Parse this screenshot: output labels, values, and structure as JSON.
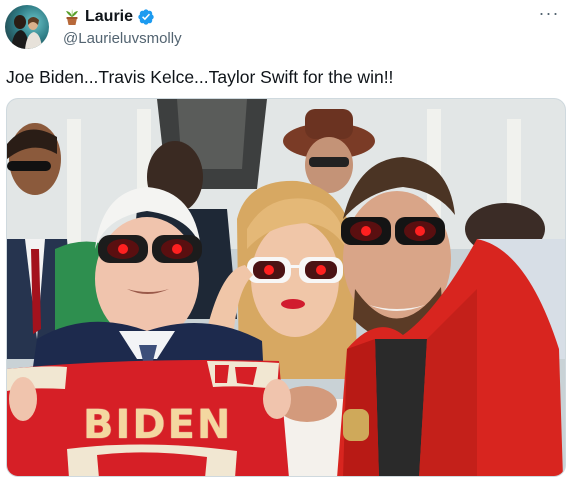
{
  "author": {
    "display_name": "Laurie",
    "handle": "@Laurieluvsmolly",
    "verified": true,
    "name_prefix_icon": "potted-plant-icon",
    "avatar_icon": "profile-photo"
  },
  "menu": {
    "more_icon": "more-horizontal-icon",
    "more_glyph": "···"
  },
  "tweet": {
    "text": "Joe Biden...Travis Kelce...Taylor Swift for the win!!"
  },
  "media": {
    "jersey_text": "BIDEN",
    "colors": {
      "jersey_red": "#d61f26",
      "jacket_red": "#d8251f",
      "glasses_red": "#ff1a1a"
    }
  },
  "colors": {
    "text": "#0f1419",
    "secondary": "#536471",
    "verified": "#1d9bf0",
    "border": "#cfd9de"
  }
}
